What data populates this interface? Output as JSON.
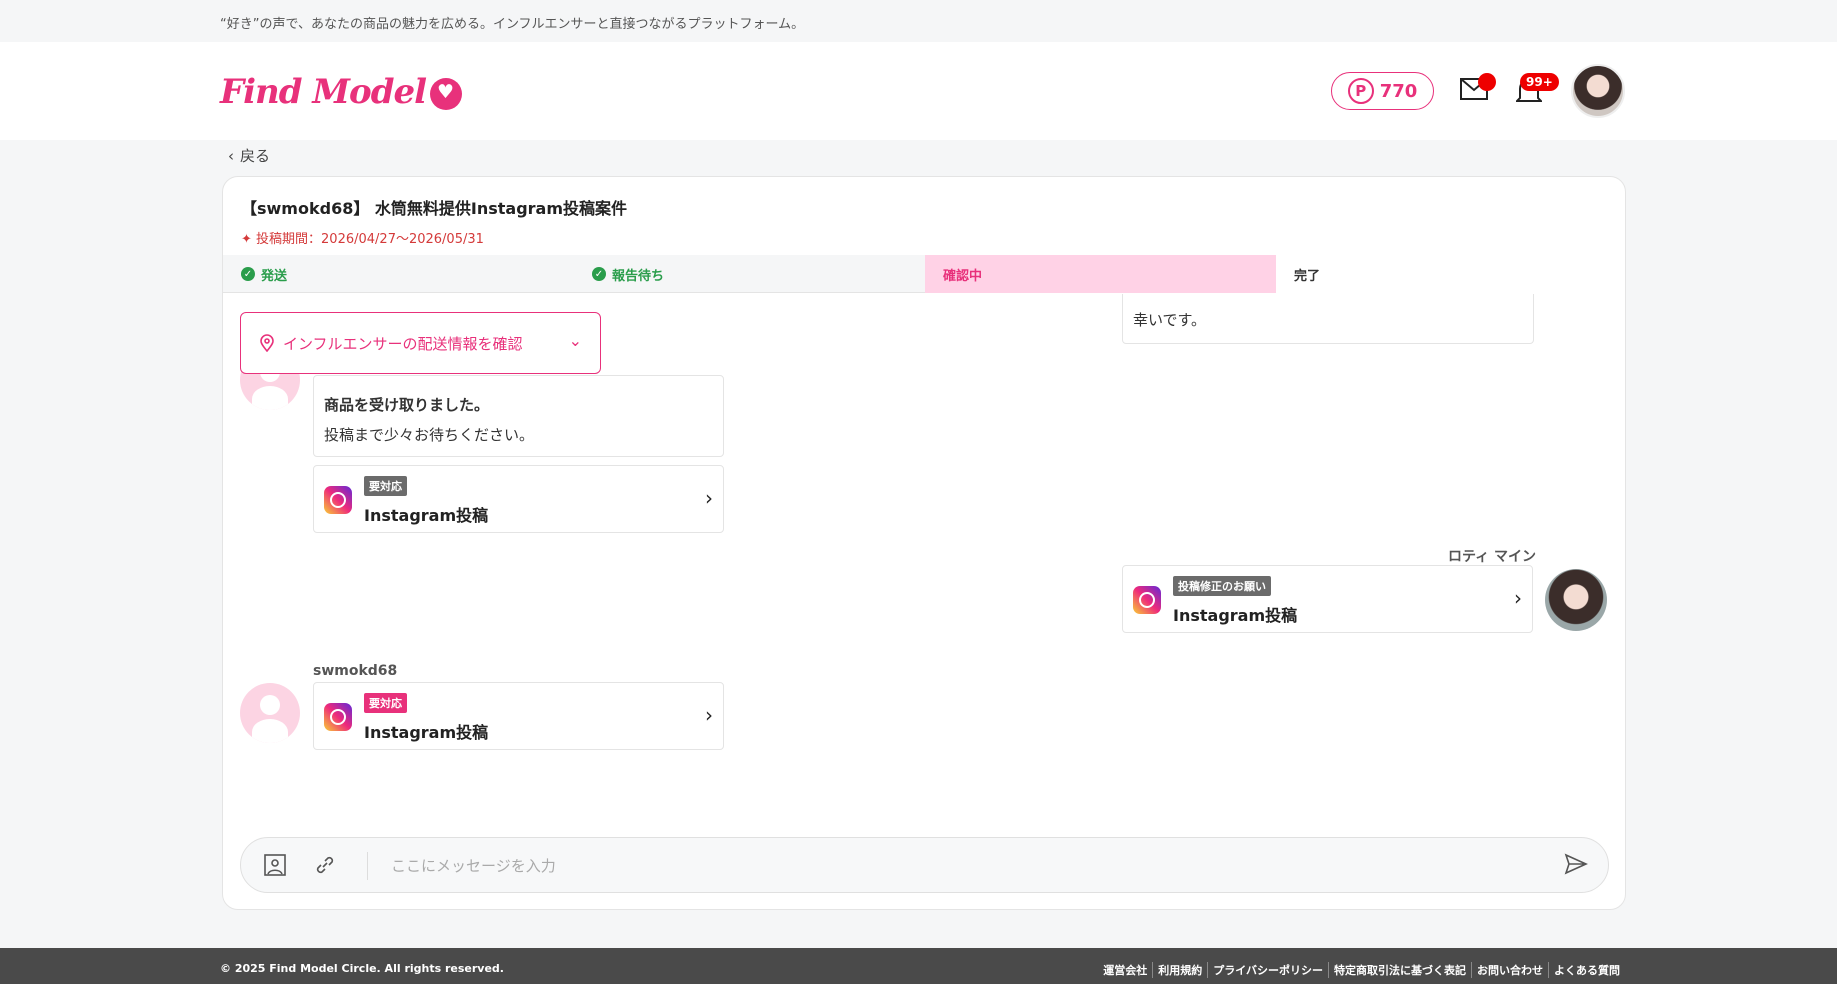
{
  "tagline": "“好き”の声で、あなたの商品の魅力を広める。インフルエンサーと直接つながるプラットフォーム。",
  "header": {
    "logo": "Find Model",
    "points": "770",
    "points_symbol": "P",
    "notif_badge": "99+"
  },
  "back_label": "戻る",
  "campaign": {
    "title": "【swmokd68】 水筒無料提供Instagram投稿案件",
    "period": "投稿期間：2026/04/27〜2026/05/31"
  },
  "steps": [
    {
      "label": "発送",
      "status": "done"
    },
    {
      "label": "報告待ち",
      "status": "done"
    },
    {
      "label": "確認中",
      "status": "active"
    },
    {
      "label": "完了",
      "status": "todo"
    }
  ],
  "chat": {
    "top_bubble_text": "幸いです。",
    "shipping_button": "インフルエンサーの配送情報を確認",
    "received_title": "商品を受け取りました。",
    "received_body": "投稿まで少々お待ちください。",
    "task1": {
      "tag": "要対応",
      "label": "Instagram投稿"
    },
    "my_name": "ロティ マイン",
    "task2": {
      "tag": "投稿修正のお願い",
      "label": "Instagram投稿"
    },
    "user_name": "swmokd68",
    "task3": {
      "tag": "要対応",
      "label": "Instagram投稿"
    }
  },
  "input": {
    "placeholder": "ここにメッセージを入力"
  },
  "footer": {
    "copyright": "© 2025 Find Model Circle. All rights reserved.",
    "links": [
      "運営会社",
      "利用規約",
      "プライバシーポリシー",
      "特定商取引法に基づく表記",
      "お問い合わせ",
      "よくある質問"
    ]
  },
  "colors": {
    "brand": "#e8317b",
    "done": "#2a9d4b",
    "active_bg": "#ffd2e6"
  }
}
